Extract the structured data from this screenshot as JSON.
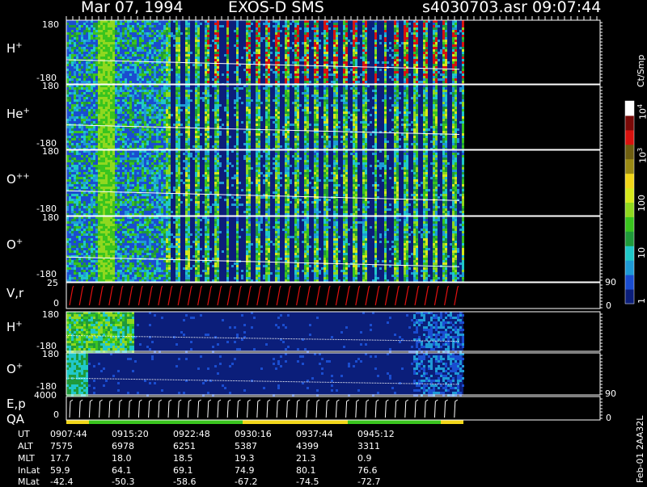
{
  "header": {
    "date": "Mar 07, 1994",
    "instrument": "EXOS-D SMS",
    "filename": "s4030703.asr",
    "time": "09:07:44"
  },
  "panels": [
    {
      "species": "H",
      "charge": "+",
      "ymax": "180",
      "ymin": "-180"
    },
    {
      "species": "He",
      "charge": "+",
      "ymax": "180",
      "ymin": "-180"
    },
    {
      "species": "O",
      "charge": "++",
      "ymax": "180",
      "ymin": "-180"
    },
    {
      "species": "O",
      "charge": "+",
      "ymax": "180",
      "ymin": "-180"
    }
  ],
  "vr_panel": {
    "label": "V,r",
    "ymax": "25",
    "ymin": "0",
    "right_top": "90",
    "right_bottom": "0"
  },
  "h2_panel": {
    "species": "H",
    "charge": "+",
    "ymax": "180",
    "ymin": "-180"
  },
  "o2_panel": {
    "species": "O",
    "charge": "+",
    "ymax": "180",
    "ymin": "-180"
  },
  "ep_panel": {
    "label": "E,p",
    "ymax": "4000",
    "ymin": "0",
    "right_top": "90",
    "right_bottom": "0"
  },
  "qa_label": "QA",
  "colorbar": {
    "units": "Ct/Smp",
    "labels": [
      "1",
      "10",
      "100",
      "10",
      "10"
    ],
    "exponents": [
      "",
      "",
      "",
      "3",
      "4"
    ],
    "colors": [
      "#0b1e7a",
      "#1a4dd0",
      "#1e9ad6",
      "#20c8c8",
      "#1f9a3a",
      "#39c41e",
      "#8fd81f",
      "#d6e81c",
      "#f1d619",
      "#9a8a14",
      "#6e5e10",
      "#d8120e",
      "#7a0a08",
      "#ffffff"
    ]
  },
  "ephemeris": {
    "rows": [
      "UT",
      "ALT",
      "MLT",
      "InLat",
      "MLat"
    ],
    "columns": [
      [
        "0907:44",
        "7575",
        "17.7",
        "59.9",
        "-42.4"
      ],
      [
        "0915:20",
        "6978",
        "18.0",
        "64.1",
        "-50.3"
      ],
      [
        "0922:48",
        "6251",
        "18.5",
        "69.1",
        "-58.6"
      ],
      [
        "0930:16",
        "5387",
        "19.3",
        "74.9",
        "-67.2"
      ],
      [
        "0937:44",
        "4399",
        "21.3",
        "80.1",
        "-74.5"
      ],
      [
        "0945:12",
        "3311",
        "0.9",
        "76.6",
        "-72.7"
      ]
    ]
  },
  "side_note": "Feb-01 2AA32L",
  "chart_data": {
    "type": "heatmap",
    "title": "Mar 07, 1994   EXOS-D SMS",
    "xlabel": "UT",
    "x_ticks": [
      "0907:44",
      "0915:20",
      "0922:48",
      "0930:16",
      "0937:44",
      "0945:12"
    ],
    "panels": [
      "H+",
      "He+",
      "O++",
      "O+",
      "V,r",
      "H+",
      "O+",
      "E,p",
      "QA"
    ],
    "ylim_pitch": [
      -180,
      180
    ],
    "colorbar_units": "Ct/Smp",
    "colorbar_range": [
      1,
      10000
    ],
    "colorbar_scale": "log"
  }
}
